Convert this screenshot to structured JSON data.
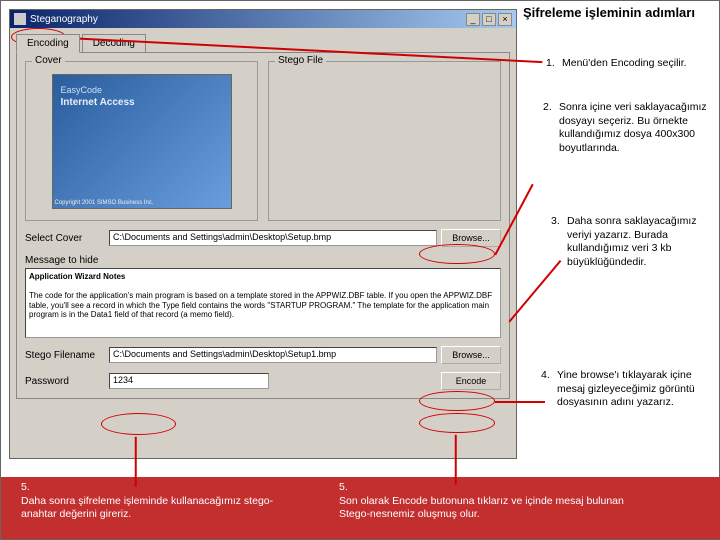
{
  "window": {
    "title": "Steganography",
    "min": "_",
    "max": "□",
    "close": "×"
  },
  "tabs": {
    "encoding": "Encoding",
    "decoding": "Decoding"
  },
  "panels": {
    "cover": "Cover",
    "stego": "Stego File",
    "thumb_overlay1": "EasyCode",
    "thumb_overlay2": "Internet Access",
    "thumb_caption": "Copyright 2001 SIMSO Business Inc."
  },
  "fields": {
    "select_cover_label": "Select Cover",
    "select_cover_value": "C:\\Documents and Settings\\admin\\Desktop\\Setup.bmp",
    "browse": "Browse...",
    "message_label": "Message to hide",
    "textarea_title": "Application Wizard Notes",
    "textarea_body": "The code for the application's main program is based on a template stored in the APPWIZ.DBF table. If you open the APPWIZ.DBF table, you'll see a record in which the Type field contains the words \"STARTUP PROGRAM.\" The template for the application main program is in the Data1 field of that record (a memo field).",
    "stego_filename_label": "Stego Filename",
    "stego_filename_value": "C:\\Documents and Settings\\admin\\Desktop\\Setup1.bmp",
    "password_label": "Password",
    "password_value": "1234",
    "encode": "Encode"
  },
  "instructions": {
    "title": "Şifreleme işleminin adımları",
    "s1_num": "1.",
    "s1": "Menü'den Encoding seçilir.",
    "s2_num": "2.",
    "s2": "Sonra içine veri saklayacağımız dosyayı seçeriz. Bu örnekte kullandığımız dosya 400x300 boyutlarında.",
    "s3_num": "3.",
    "s3": "Daha sonra saklayacağımız veriyi yazarız. Burada kullandığımız veri 3 kb büyüklüğündedir.",
    "s4_num": "4.",
    "s4": "Yine browse'ı tıklayarak içine mesaj gizleyeceğimiz görüntü dosyasının adını yazarız.",
    "s5_num": "5.",
    "s5": "Daha sonra şifreleme işleminde kullanacağımız stego-anahtar değerini gireriz.",
    "s6_num": "5.",
    "s6": "Son olarak Encode butonuna tıklarız ve içinde mesaj bulunan Stego-nesnemiz oluşmuş olur."
  }
}
